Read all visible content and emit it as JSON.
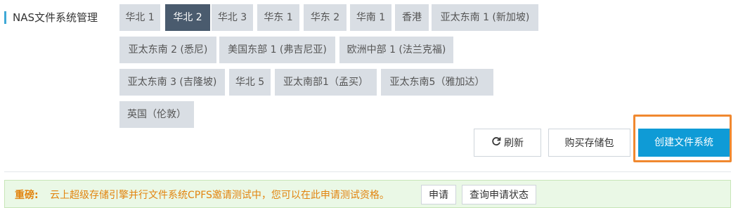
{
  "page": {
    "title": "NAS文件系统管理"
  },
  "regions": [
    {
      "label": "华北 1",
      "active": false
    },
    {
      "label": "华北 2",
      "active": true
    },
    {
      "label": "华北 3",
      "active": false
    },
    {
      "label": "华东 1",
      "active": false
    },
    {
      "label": "华东 2",
      "active": false
    },
    {
      "label": "华南 1",
      "active": false
    },
    {
      "label": "香港",
      "active": false
    },
    {
      "label": "亚太东南 1 (新加坡)",
      "active": false
    },
    {
      "label": "亚太东南 2 (悉尼)",
      "active": false
    },
    {
      "label": "美国东部 1 (弗吉尼亚)",
      "active": false
    },
    {
      "label": "欧洲中部 1 (法兰克福)",
      "active": false
    },
    {
      "label": "亚太东南 3 (吉隆坡)",
      "active": false
    },
    {
      "label": "华北 5",
      "active": false
    },
    {
      "label": "亚太南部1（孟买）",
      "active": false
    },
    {
      "label": "亚太东南5（雅加达）",
      "active": false
    },
    {
      "label": "英国（伦敦）",
      "active": false
    }
  ],
  "actions": {
    "refresh": "刷新",
    "buy_storage": "购买存储包",
    "create": "创建文件系统",
    "refresh_icon": "refresh-icon"
  },
  "notice": {
    "label": "重磅:",
    "text": "云上超级存储引擎并行文件系统CPFS邀请测试中，您可以在此申请测试资格。",
    "apply": "申请",
    "query": "查询申请状态"
  },
  "colors": {
    "active_tab": "#4a5b6e",
    "tab": "#d9dee4",
    "primary": "#0f9bd6",
    "highlight": "#f0882f",
    "notice_text": "#e2840f"
  }
}
